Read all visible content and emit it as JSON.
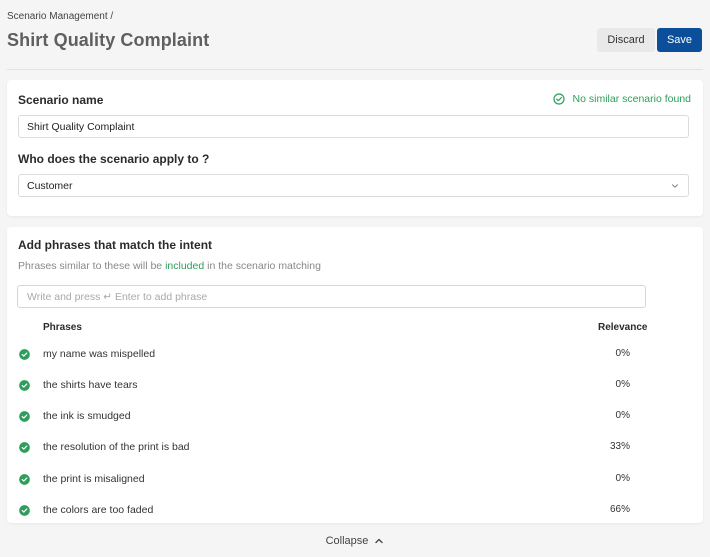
{
  "header": {
    "breadcrumb": "Scenario Management /",
    "title": "Shirt Quality Complaint",
    "discard_label": "Discard",
    "save_label": "Save"
  },
  "scenario": {
    "name_label": "Scenario name",
    "status_text": "No similar scenario found",
    "name_value": "Shirt Quality Complaint",
    "applies_label": "Who does the scenario apply to ?",
    "applies_value": "Customer"
  },
  "phrases": {
    "title": "Add phrases that match the intent",
    "subtext_before": "Phrases similar to these will be ",
    "subtext_highlight": "included",
    "subtext_after": " in the scenario matching",
    "input_placeholder": "Write and press ↵ Enter to add phrase",
    "col_phrases": "Phrases",
    "col_relevance": "Relevance",
    "rows": [
      {
        "text": "my name was mispelled",
        "relevance": "0%"
      },
      {
        "text": "the shirts have tears",
        "relevance": "0%"
      },
      {
        "text": "the ink is smudged",
        "relevance": "0%"
      },
      {
        "text": "the resolution of the print is bad",
        "relevance": "33%"
      },
      {
        "text": "the print is misaligned",
        "relevance": "0%"
      },
      {
        "text": "the colors are too faded",
        "relevance": "66%"
      }
    ]
  },
  "footer": {
    "collapse_label": "Collapse"
  },
  "colors": {
    "accent": "#0b4f9a",
    "success": "#2e9e5b"
  },
  "icons": {
    "status": "check-circle-outline-icon",
    "row_check": "check-circle-filled-icon",
    "select": "chevron-down-icon",
    "collapse": "chevron-up-icon"
  }
}
